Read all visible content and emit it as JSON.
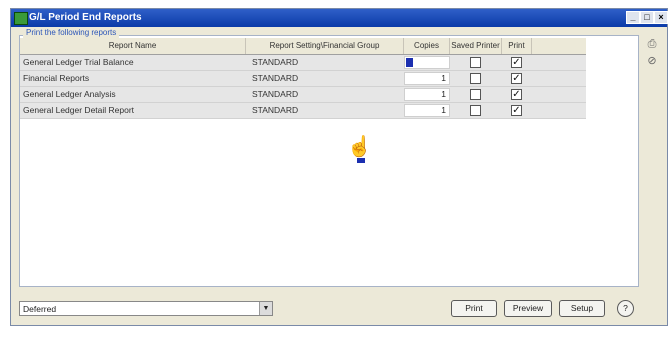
{
  "window": {
    "title": "G/L Period End Reports",
    "buttons": {
      "minimize": "_",
      "restore": "□",
      "close": "×"
    }
  },
  "group": {
    "caption": "Print the following reports"
  },
  "grid": {
    "columns": [
      "Report Name",
      "Report Setting\\Financial Group",
      "Copies",
      "Saved Printer",
      "Print"
    ],
    "rows": [
      {
        "name": "General Ledger Trial Balance",
        "setting": "STANDARD",
        "copies": "",
        "saved_printer": false,
        "print": true
      },
      {
        "name": "Financial Reports",
        "setting": "STANDARD",
        "copies": "1",
        "saved_printer": false,
        "print": true
      },
      {
        "name": "General Ledger Analysis",
        "setting": "STANDARD",
        "copies": "1",
        "saved_printer": false,
        "print": true
      },
      {
        "name": "General Ledger Detail Report",
        "setting": "STANDARD",
        "copies": "1",
        "saved_printer": false,
        "print": true
      }
    ]
  },
  "side_icons": [
    "printer-icon",
    "no-entry-icon"
  ],
  "bottom": {
    "select_value": "Deferred",
    "buttons": {
      "print": "Print",
      "preview": "Preview",
      "setup": "Setup",
      "help": "?"
    }
  }
}
